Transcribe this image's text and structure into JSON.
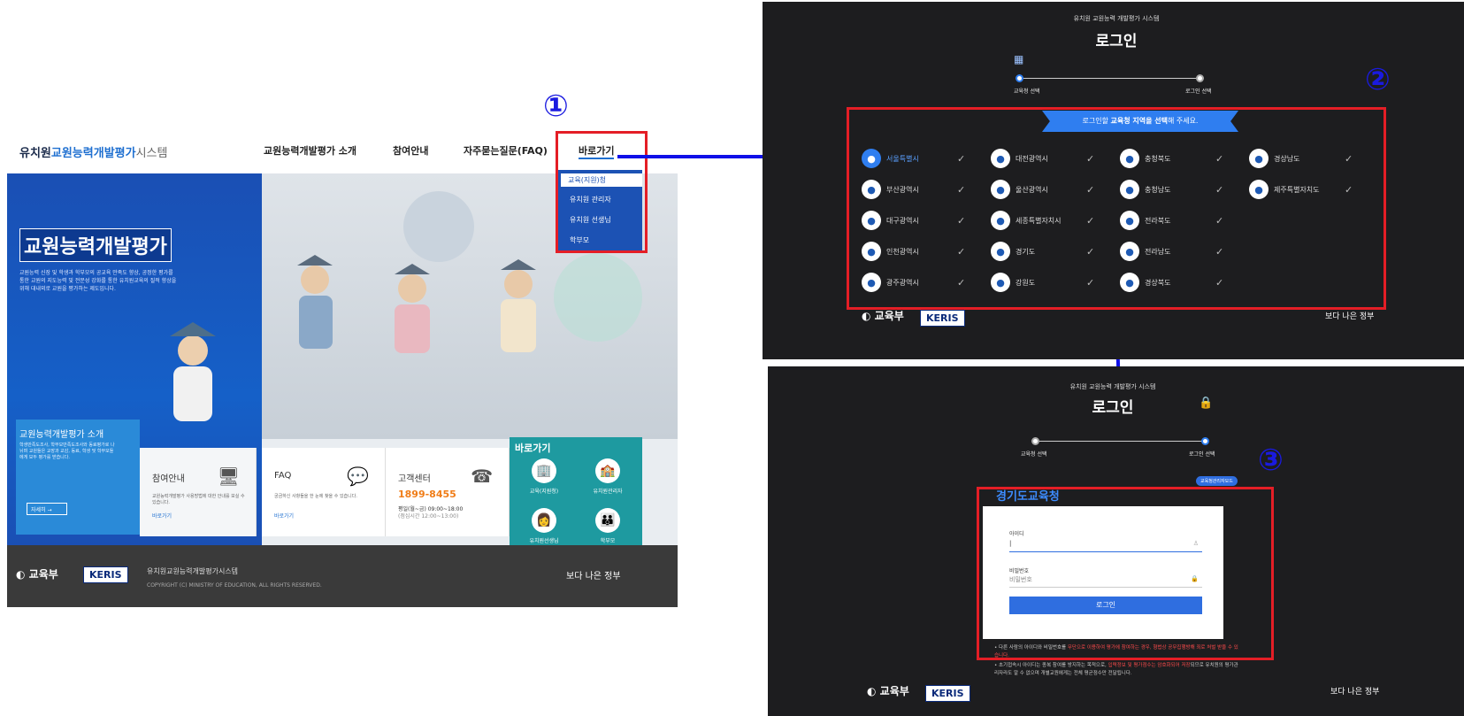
{
  "panel1": {
    "logo": {
      "a": "유치원",
      "b": "교원능력개발평가",
      "c": "시스템"
    },
    "nav": [
      "교원능력개발평가 소개",
      "참여안내",
      "자주묻는질문(FAQ)",
      "바로가기"
    ],
    "dropdown": [
      "교육(지원)청",
      "유치원 관리자",
      "유치원 선생님",
      "학부모"
    ],
    "hero_title": "교원능력개발평가",
    "hero_desc": "교원능력 신장 및 학생과 학부모의 공교육 만족도 향상, 공정한 평가를 통한 교원의 지도능력 및 전문성 강화를 통한 유치원교육의 질적 향상을 위해 대내외로 교원을 평가하는 제도입니다.",
    "intro_title": "교원능력개발평가 소개",
    "intro_desc": "학생만족도조사, 학부모만족도조사와 동료평가로 나뉘며 교원들은 교장과 교감, 동료, 학생 및 학부모들에게 모두 평가를 받습니다.",
    "intro_more": "자세히 →",
    "cards": [
      {
        "title": "참여안내",
        "desc": "교원능력개발평가 사용방법에 대한 안내를 보실 수 있습니다.",
        "link": "바로가기",
        "icon": "monitor-icon"
      },
      {
        "title": "FAQ",
        "desc": "궁금하신 사항들을 한 눈에 찾을 수 있습니다.",
        "link": "바로가기",
        "icon": "chat-icon"
      },
      {
        "title": "고객센터",
        "phone": "1899-8455",
        "hours": "평일(월~금) 09:00~18:00",
        "lunch": "(점심시간 12:00~13:00)",
        "icon": "phone-icon"
      }
    ],
    "shortcut_title": "바로가기",
    "shortcuts": [
      "교육(지원청)",
      "유치원관리자",
      "유치원선생님",
      "학부모"
    ],
    "footer_org": "교육부",
    "footer_keris": "KERIS",
    "footer_name": "유치원교원능력개발평가시스템",
    "footer_copy": "COPYRIGHT (C) MINISTRY OF EDUCATION, ALL RIGHTS RESERVED.",
    "footer_right": "보다 나은 정부"
  },
  "annotations": {
    "c1": "①",
    "c2": "②",
    "c3": "③"
  },
  "panel2": {
    "system": "유치원 교원능력 개발평가 시스템",
    "title": "로그인",
    "step1": "교육청 선택",
    "step2": "로그인 선택",
    "banner_pre": "로그인할 ",
    "banner_bold": "교육청 지역을 선택",
    "banner_post": "해 주세요.",
    "offices": [
      [
        "서울특별시",
        "대전광역시",
        "충청북도",
        "경상남도"
      ],
      [
        "부산광역시",
        "울산광역시",
        "충청남도",
        "제주특별자치도"
      ],
      [
        "대구광역시",
        "세종특별자치시",
        "전라북도"
      ],
      [
        "인천광역시",
        "경기도",
        "전라남도"
      ],
      [
        "광주광역시",
        "강원도",
        "경상북도"
      ]
    ],
    "org": "교육부",
    "keris": "KERIS",
    "right": "보다 나은 정부"
  },
  "panel3": {
    "system": "유치원 교원능력 개발평가 시스템",
    "title": "로그인",
    "step1": "교육청 선택",
    "step2": "로그인 선택",
    "change_btn": "교육청관리자모드",
    "office": "경기도교육청",
    "id_label": "아이디",
    "pw_label": "비밀번호",
    "pw_placeholder": "비밀번호",
    "login_btn": "로그인",
    "notice1a": "• 다른 사람의 아이디와 비밀번호를 ",
    "notice1b": "무단으로 이용하여 평가에 참여하는 경우, 형법상 공무집행방해 죄로 처벌 받을 수 있습니다.",
    "notice2a": "• 초기접속시 아이디는 종복 참여를 방지하는 목적으로, ",
    "notice2b": "입력정보 및 평가점수는 암호화되어 저장",
    "notice2c": "되므로 유치원의 평가관리자라도 알 수 없으며 개별교원에게는 전체 평균점수만 전달됩니다.",
    "org": "교육부",
    "keris": "KERIS",
    "right": "보다 나은 정부"
  }
}
